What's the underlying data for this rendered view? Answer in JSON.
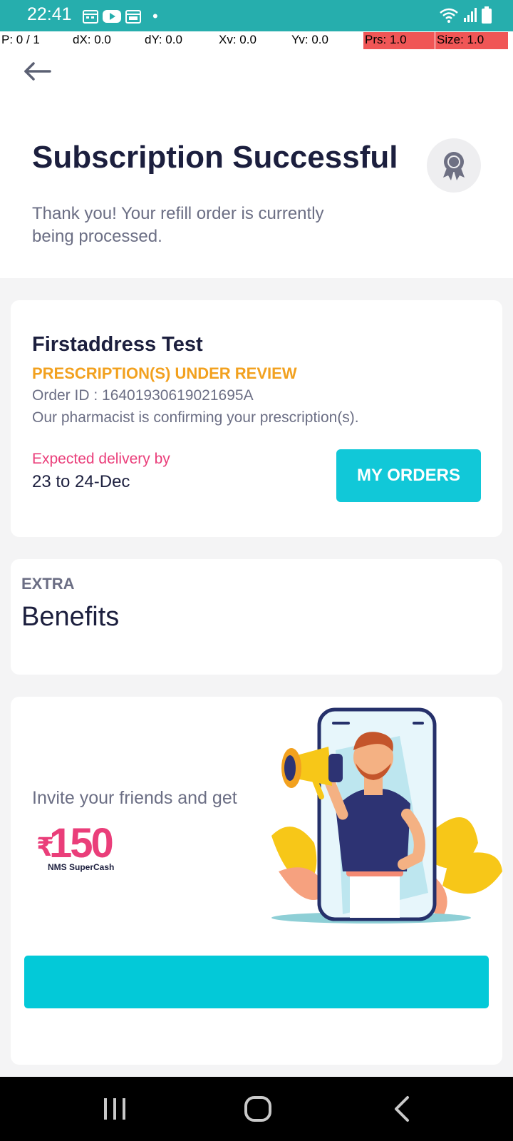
{
  "status_bar": {
    "time": "22:41",
    "dot": "•"
  },
  "debug": {
    "p": "P: 0 / 1",
    "dx": "dX: 0.0",
    "dy": "dY: 0.0",
    "xv": "Xv: 0.0",
    "yv": "Yv: 0.0",
    "prs": "Prs: 1.0",
    "size": "Size: 1.0"
  },
  "header": {
    "back_icon": "arrow-left-icon",
    "title": "Subscription Successful",
    "badge_icon": "award-ribbon-icon",
    "subtitle": "Thank you! Your refill order is currently being processed."
  },
  "order": {
    "customer_name": "Firstaddress Test",
    "status": "PRESCRIPTION(S) UNDER REVIEW",
    "order_id": "Order ID : 16401930619021695A",
    "note": "Our pharmacist is confirming your prescription(s).",
    "delivery_label": "Expected delivery by",
    "delivery_date": "23 to 24-Dec",
    "my_orders_label": "MY ORDERS"
  },
  "benefits": {
    "eyebrow": "EXTRA",
    "title": "Benefits"
  },
  "invite": {
    "text": "Invite your friends and get",
    "currency": "₹",
    "amount": "150",
    "unit": "NMS SuperCash"
  },
  "colors": {
    "status_bar": "#26aead",
    "accent_cyan": "#11c8d8",
    "status_orange": "#f2a11f",
    "pink": "#ea3e7a",
    "title_navy": "#1c1f3e"
  }
}
